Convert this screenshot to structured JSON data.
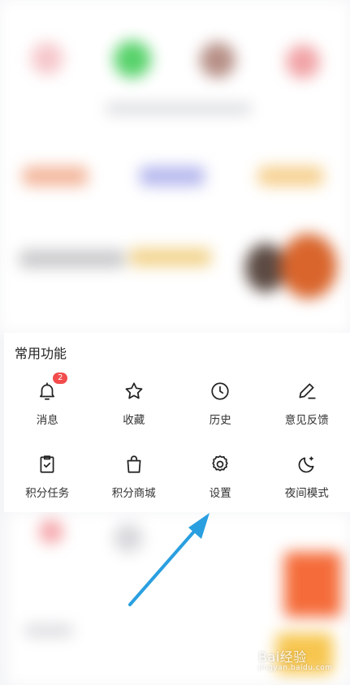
{
  "panel": {
    "title": "常用功能",
    "items": [
      {
        "label": "消息",
        "icon": "bell-icon",
        "badge": "2"
      },
      {
        "label": "收藏",
        "icon": "star-icon",
        "badge": null
      },
      {
        "label": "历史",
        "icon": "clock-icon",
        "badge": null
      },
      {
        "label": "意见反馈",
        "icon": "pencil-icon",
        "badge": null
      },
      {
        "label": "积分任务",
        "icon": "clipboard-check-icon",
        "badge": null
      },
      {
        "label": "积分商城",
        "icon": "shopping-bag-icon",
        "badge": null
      },
      {
        "label": "设置",
        "icon": "gear-icon",
        "badge": null
      },
      {
        "label": "夜间模式",
        "icon": "moon-icon",
        "badge": null
      }
    ]
  },
  "annotation": {
    "arrow_color": "#2a9fe0"
  },
  "watermark": {
    "text": "Bai经验",
    "sub": "jingyan.baidu.com"
  },
  "colors": {
    "badge": "#f24c4c",
    "icon": "#222222",
    "text": "#333333"
  }
}
